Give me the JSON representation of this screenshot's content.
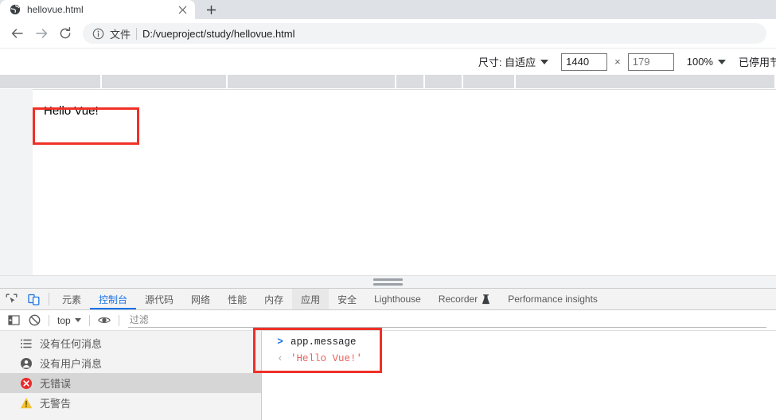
{
  "browser": {
    "tab": {
      "title": "hellovue.html",
      "favicon_icon": "globe-icon",
      "close_icon": "close-icon"
    },
    "new_tab_label": "+",
    "nav": {
      "back_icon": "arrow-left-icon",
      "forward_icon": "arrow-right-icon",
      "reload_icon": "reload-icon"
    },
    "omnibox": {
      "info_icon": "info-circle-icon",
      "scheme_label": "文件",
      "url": "D:/vueproject/study/hellovue.html"
    }
  },
  "device_toolbar": {
    "size_label": "尺寸: 自适应",
    "width_value": "1440",
    "height_placeholder": "179",
    "multiply_symbol": "×",
    "zoom_label": "100%",
    "throttling_label": "已停用节流模式"
  },
  "ruler": {
    "segments": [
      128,
      158,
      212,
      37,
      48,
      66,
      327
    ]
  },
  "page": {
    "heading": "Hello Vue!"
  },
  "annotations": {
    "hello_box_color": "#f03027",
    "console_box_color": "#f03027"
  },
  "devtools": {
    "inspect_icon": "inspect-cursor-icon",
    "device_toggle_icon": "device-toolbar-icon",
    "tabs": [
      {
        "label": "元素",
        "state": "normal"
      },
      {
        "label": "控制台",
        "state": "selected"
      },
      {
        "label": "源代码",
        "state": "normal"
      },
      {
        "label": "网络",
        "state": "normal"
      },
      {
        "label": "性能",
        "state": "normal"
      },
      {
        "label": "内存",
        "state": "normal"
      },
      {
        "label": "应用",
        "state": "hovered"
      },
      {
        "label": "安全",
        "state": "normal"
      },
      {
        "label": "Lighthouse",
        "state": "normal"
      },
      {
        "label": "Recorder",
        "state": "normal",
        "icon": "flask-icon"
      },
      {
        "label": "Performance insights",
        "state": "normal"
      }
    ],
    "console_toolbar": {
      "sidebar_toggle_icon": "sidebar-toggle-icon",
      "clear_icon": "clear-console-icon",
      "context_label": "top",
      "eye_icon": "live-expression-eye-icon",
      "filter_placeholder": "过滤",
      "filter_value": ""
    },
    "console_sidebar": [
      {
        "label": "没有任何消息",
        "icon": "list-icon",
        "selected": false
      },
      {
        "label": "没有用户消息",
        "icon": "person-icon",
        "selected": false
      },
      {
        "label": "无错误",
        "icon": "error-icon",
        "selected": true
      },
      {
        "label": "无警告",
        "icon": "warning-icon",
        "selected": false
      }
    ],
    "console_messages": [
      {
        "arrow": ">",
        "text": "app.message",
        "kind": "input"
      },
      {
        "arrow": "‹",
        "text": "'Hello Vue!'",
        "kind": "output"
      }
    ]
  },
  "colors": {
    "accent": "#1a73e8",
    "annotation_red": "#f03027",
    "error_red": "#e8625c",
    "warning_yellow": "#f2c230"
  }
}
